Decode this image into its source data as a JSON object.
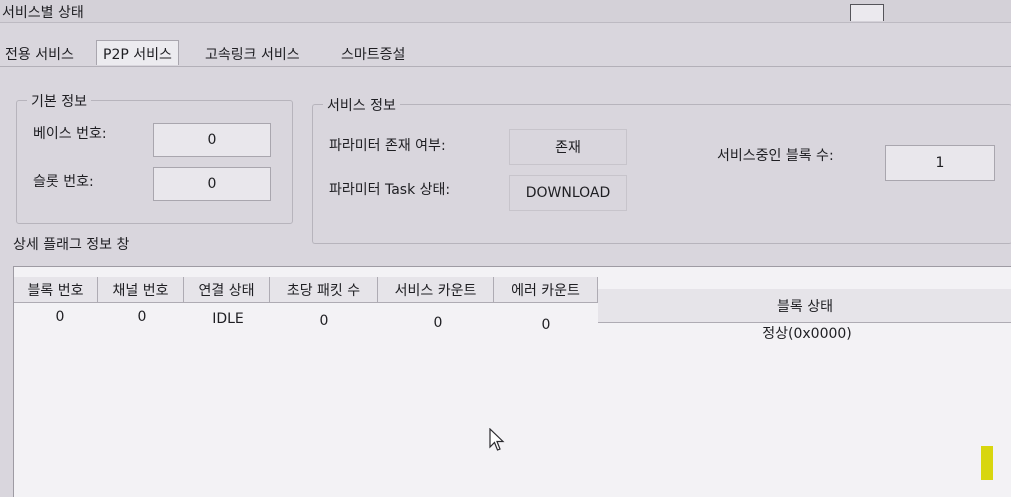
{
  "window": {
    "title": "서비스별 상태"
  },
  "tabs": [
    "전용 서비스",
    "P2P 서비스",
    "고속링크 서비스",
    "스마트증설"
  ],
  "basic_info": {
    "legend": "기본 정보",
    "base_label": "베이스 번호:",
    "base_value": "0",
    "slot_label": "슬롯 번호:",
    "slot_value": "0"
  },
  "service_info": {
    "legend": "서비스 정보",
    "param_exist_label": "파라미터 존재 여부:",
    "param_exist_value": "존재",
    "param_task_label": "파라미터 Task 상태:",
    "param_task_value": "DOWNLOAD",
    "active_blocks_label": "서비스중인 블록 수:",
    "active_blocks_value": "1"
  },
  "detail": {
    "title": "상세 플래그 정보 창",
    "columns": [
      "블록 번호",
      "채널 번호",
      "연결 상태",
      "초당 패킷 수",
      "서비스 카운트",
      "에러 카운트",
      "블록 상태"
    ],
    "rows": [
      [
        "0",
        "0",
        "IDLE",
        "0",
        "0",
        "0",
        "정상(0x0000)"
      ]
    ]
  },
  "colors": {
    "window_bg": "#d9d6dd",
    "list_bg": "#f3f2f5",
    "marker": "#d8d60e"
  }
}
